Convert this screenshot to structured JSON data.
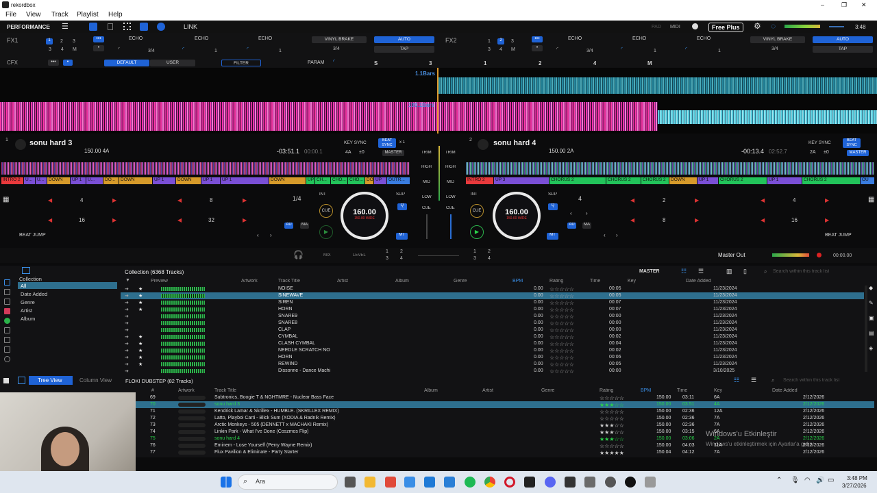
{
  "window": {
    "title": "rekordbox",
    "controls": [
      "–",
      "❐",
      "✕"
    ]
  },
  "menu": [
    "File",
    "View",
    "Track",
    "Playlist",
    "Help"
  ],
  "toolbar": {
    "mode": "PERFORMANCE",
    "link": "LINK",
    "pad": "PAD",
    "midi": "MIDI",
    "plan": "Free Plus",
    "time": "3:48"
  },
  "fx1": {
    "label": "FX1",
    "nums": [
      "1",
      "2",
      "3",
      "3",
      "4",
      "M"
    ],
    "effects": [
      "ECHO",
      "ECHO",
      "ECHO"
    ],
    "beat": "3/4",
    "vals": [
      "1",
      "1"
    ],
    "vinyl": "VINYL BRAKE",
    "beat2": "3/4",
    "auto": "AUTO",
    "tap": "TAP"
  },
  "fx2": {
    "label": "FX2",
    "nums": [
      "1",
      "2",
      "3",
      "3",
      "4",
      "M"
    ],
    "effects": [
      "ECHO",
      "ECHO",
      "ECHO"
    ],
    "beat": "3/4",
    "vals": [
      "1",
      "1"
    ],
    "vinyl": "VINYL BRAKE",
    "beat2": "3/4",
    "auto": "AUTO",
    "tap": "TAP"
  },
  "cfx": {
    "label": "CFX",
    "default": "DEFAULT",
    "user": "USER",
    "filter": "FILTER",
    "param": "PARAM",
    "letters": [
      "S",
      "3",
      "1",
      "2",
      "4",
      "M"
    ]
  },
  "wave": {
    "top_label": "1.1Bars",
    "bottom_label": "109.1Bars"
  },
  "deck1": {
    "num": "1",
    "title": "sonu hard 3",
    "bpm_key": "150.00 4A",
    "remain": "-03:51.1",
    "elapsed": "00:00.1",
    "key_sync": "KEY SYNC",
    "beat_sync": "BEAT SYNC",
    "key_shift": "4A",
    "key_adj": "±0",
    "master": "MASTER",
    "x1": "x 1",
    "cues": [
      {
        "t": "INTRO 2",
        "c": "#e8393c"
      },
      {
        "t": "U...",
        "c": "#7a4fd6"
      },
      {
        "t": "U...",
        "c": "#7a4fd6"
      },
      {
        "t": "DOWN",
        "c": "#d69a2a"
      },
      {
        "t": "UP 1",
        "c": "#7a4fd6"
      },
      {
        "t": "U...",
        "c": "#7a4fd6"
      },
      {
        "t": "DO...",
        "c": "#d69a2a"
      },
      {
        "t": "DOWN",
        "c": "#d69a2a"
      },
      {
        "t": "UP 1",
        "c": "#7a4fd6"
      },
      {
        "t": "DOWN",
        "c": "#d69a2a"
      },
      {
        "t": "UP 1",
        "c": "#7a4fd6"
      },
      {
        "t": "UP 1",
        "c": "#7a4fd6"
      },
      {
        "t": "DOWN",
        "c": "#d69a2a"
      },
      {
        "t": "UP",
        "c": "#22c35a"
      },
      {
        "t": "CH...",
        "c": "#22c35a"
      },
      {
        "t": "CHO...",
        "c": "#22c35a"
      },
      {
        "t": "CHO...",
        "c": "#22c35a"
      },
      {
        "t": "DO",
        "c": "#d69a2a"
      },
      {
        "t": "UP",
        "c": "#7a4fd6"
      },
      {
        "t": "OUTR...",
        "c": "#3a7de0"
      }
    ],
    "loop": "1/4",
    "pads": [
      "4",
      "8",
      "16",
      "32"
    ],
    "beat_jump": "BEAT JUMP",
    "int": "INT",
    "cue": "CUE",
    "slip": "SLIP",
    "q": "Q",
    "au": "AU",
    "ma": "MA",
    "mt": "MT",
    "jog_bpm": "160.00",
    "jog_sub": "150.00 WIDE"
  },
  "deck2": {
    "num": "2",
    "title": "sonu hard 4",
    "bpm_key": "150.00 2A",
    "remain": "-00:13.4",
    "elapsed": "02:52.7",
    "key_sync": "KEY SYNC",
    "beat_sync": "BEAT SYNC",
    "key_shift": "2A",
    "key_adj": "±0",
    "master": "MASTER",
    "cues": [
      {
        "t": "INTRO 2",
        "c": "#e8393c"
      },
      {
        "t": "UP 3",
        "c": "#7a4fd6"
      },
      {
        "t": "CHORUS 2",
        "c": "#22c35a"
      },
      {
        "t": "CHORUS 2",
        "c": "#22c35a"
      },
      {
        "t": "CHORUS 2",
        "c": "#22c35a"
      },
      {
        "t": "DOWN",
        "c": "#d69a2a"
      },
      {
        "t": "UP 1",
        "c": "#7a4fd6"
      },
      {
        "t": "CHORUS 2",
        "c": "#22c35a"
      },
      {
        "t": "UP 1",
        "c": "#7a4fd6"
      },
      {
        "t": "CHORUS 2",
        "c": "#22c35a"
      },
      {
        "t": "OU",
        "c": "#3a7de0"
      }
    ],
    "loop": "4",
    "pads": [
      "2",
      "4",
      "8",
      "16"
    ],
    "beat_jump": "BEAT JUMP",
    "int": "INT",
    "cue": "CUE",
    "slip": "SLIP",
    "q": "Q",
    "au": "AU",
    "ma": "MA",
    "mt": "MT",
    "jog_bpm": "160.00",
    "jog_sub": "150.00 WIDE"
  },
  "mixer": {
    "trim": "TRIM",
    "high": "HIGH",
    "mid": "MID",
    "low": "LOW",
    "cue": "CUE",
    "mix": "MIX",
    "level": "LEVEL",
    "nums": [
      "1",
      "2",
      "3",
      "4"
    ],
    "master_out": "Master Out",
    "time": "00:00.00"
  },
  "tree": {
    "root": "Collection",
    "items": [
      "All",
      "Date Added",
      "Genre",
      "Artist",
      "Album"
    ]
  },
  "collection": {
    "title": "Collection (6368 Tracks)",
    "master": "MASTER",
    "search": "Search within this track list",
    "headers": [
      "Preview",
      "Artwork",
      "Track Title",
      "Artist",
      "Album",
      "Genre",
      "BPM",
      "Rating",
      "Time",
      "Key",
      "Date Added"
    ],
    "rows": [
      {
        "title": "NOISE",
        "bpm": "0.00",
        "time": "00:05",
        "date": "11/23/2024",
        "star": "★"
      },
      {
        "title": "SINEWAVE",
        "bpm": "0.00",
        "time": "00:05",
        "date": "11/23/2024",
        "star": "★",
        "sel": true
      },
      {
        "title": "SIREN",
        "bpm": "0.00",
        "time": "00:07",
        "date": "11/23/2024",
        "star": "★"
      },
      {
        "title": "HORN",
        "bpm": "0.00",
        "time": "00:07",
        "date": "11/23/2024",
        "star": "★"
      },
      {
        "title": "SNARE9",
        "bpm": "0.00",
        "time": "00:00",
        "date": "11/23/2024",
        "star": ""
      },
      {
        "title": "SNARE8",
        "bpm": "0.00",
        "time": "00:00",
        "date": "11/23/2024",
        "star": ""
      },
      {
        "title": "CLAP",
        "bpm": "0.00",
        "time": "00:00",
        "date": "11/23/2024",
        "star": ""
      },
      {
        "title": "CYMBAL",
        "bpm": "0.00",
        "time": "00:02",
        "date": "11/23/2024",
        "star": "★"
      },
      {
        "title": "CLASH CYMBAL",
        "bpm": "0.00",
        "time": "00:04",
        "date": "11/23/2024",
        "star": "★"
      },
      {
        "title": "NEEDLE SCRATCH NO",
        "bpm": "0.00",
        "time": "00:02",
        "date": "11/23/2024",
        "star": "★"
      },
      {
        "title": "HORN",
        "bpm": "0.00",
        "time": "00:06",
        "date": "11/23/2024",
        "star": "★"
      },
      {
        "title": "REWIND",
        "bpm": "0.00",
        "time": "00:05",
        "date": "11/23/2024",
        "star": "★"
      },
      {
        "title": "Dissonne - Dance Machi",
        "bpm": "0.00",
        "time": "00:00",
        "date": "3/10/2025",
        "star": ""
      }
    ]
  },
  "lower": {
    "tree_view": "Tree View",
    "column_view": "Column View",
    "playlist": "FLOKI DUBSTEP (82 Tracks)",
    "search": "Search within this track list",
    "headers": [
      "#",
      "Artwork",
      "Track Title",
      "Album",
      "Artist",
      "Genre",
      "Rating",
      "BPM",
      "Time",
      "Key",
      "Date Added"
    ],
    "rows": [
      {
        "n": "69",
        "title": "Subtronics, Boogie T & NGHTMRE - Nuclear Bass Face",
        "rating": "☆☆☆☆☆",
        "bpm": "150.00",
        "time": "03:11",
        "key": "6A",
        "date": "2/12/2026"
      },
      {
        "n": "70",
        "title": "sonu hard 3",
        "rating": "★★★☆☆",
        "bpm": "150.00",
        "time": "03:51",
        "key": "4A",
        "date": "2/12/2026",
        "sel": true,
        "green": true
      },
      {
        "n": "71",
        "title": "Kendrick Lamar & Skrillex - HUMBLE. (SKRILLEX REMIX)",
        "rating": "☆☆☆☆☆",
        "bpm": "150.00",
        "time": "02:36",
        "key": "12A",
        "date": "2/12/2026"
      },
      {
        "n": "72",
        "title": "Latto, Playboi Carti - Blick Sum (XODIA & Radnik Remix)",
        "rating": "☆☆☆☆☆",
        "bpm": "150.00",
        "time": "02:36",
        "key": "7A",
        "date": "2/12/2026"
      },
      {
        "n": "73",
        "title": "Arctic Monkeys - 505 (DENNETT x MACHAKI Remix)",
        "rating": "★★★☆☆",
        "bpm": "150.00",
        "time": "02:36",
        "key": "7A",
        "date": "2/12/2026"
      },
      {
        "n": "74",
        "title": "Linkin Park - What I've Done (Coszmos Flip)",
        "rating": "★★★☆☆",
        "bpm": "150.00",
        "time": "03:15",
        "key": "6A",
        "date": "2/12/2026"
      },
      {
        "n": "75",
        "title": "sonu hard 4",
        "rating": "★★★☆☆",
        "bpm": "150.00",
        "time": "03:06",
        "key": "2A",
        "date": "2/12/2026",
        "green": true
      },
      {
        "n": "76",
        "title": "Eminem - Lose Yourself (Perry Wayne Remix)",
        "rating": "☆☆☆☆☆",
        "bpm": "150.00",
        "time": "04:03",
        "key": "11A",
        "date": "2/12/2026"
      },
      {
        "n": "77",
        "title": "Flux Pavilion & Eliminate - Party Starter",
        "rating": "★★★★★",
        "bpm": "150.04",
        "time": "04:12",
        "key": "7A",
        "date": "2/12/2026"
      }
    ]
  },
  "watermark": {
    "line1": "Windows'u Etkinleştir",
    "line2": "Windows'u etkinleştirmek için Ayarlar'a gidin."
  },
  "taskbar": {
    "search": "Ara",
    "time": "3:48 PM",
    "date": "3/27/2026"
  }
}
